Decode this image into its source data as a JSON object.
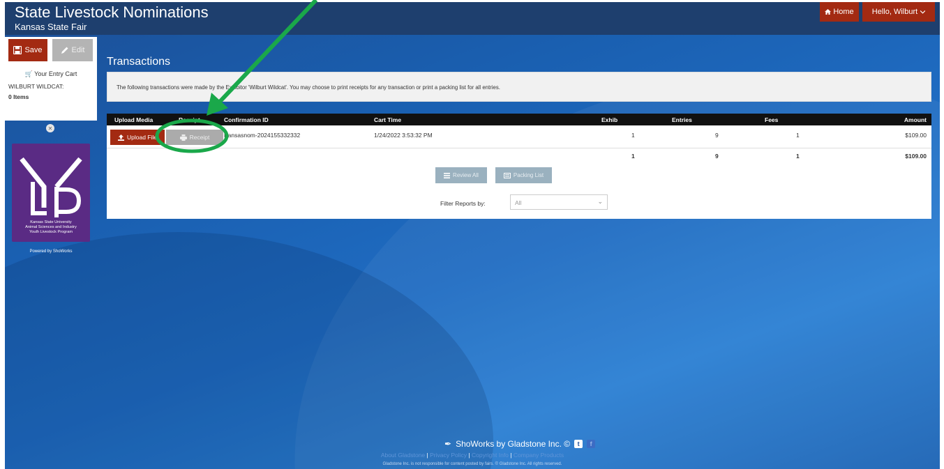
{
  "header": {
    "title": "State Livestock Nominations",
    "subtitle": "Kansas State Fair",
    "home_label": "Home",
    "user_label": "Hello, Wilburt"
  },
  "sidebar": {
    "save_label": "Save",
    "edit_label": "Edit",
    "cart_heading": "Your Entry Cart",
    "cart_user": "WILBURT WILDCAT:",
    "cart_items": "0 Items",
    "logo_caption_1": "Kansas State University",
    "logo_caption_2": "Animal Sciences and Industry",
    "logo_caption_3": "Youth Livestock Program",
    "powered_by": "Powered by ShoWorks"
  },
  "main": {
    "page_title": "Transactions",
    "info_text": "The following transactions were made by the Exhibitor 'Wilburt Wildcat'. You may choose to print receipts for any transaction or print a packing list for all entries.",
    "columns": {
      "upload_media": "Upload Media",
      "receipt": "Receipt",
      "confirmation_id": "Confirmation ID",
      "cart_time": "Cart Time",
      "exhib": "Exhib",
      "entries": "Entries",
      "fees": "Fees",
      "amount": "Amount"
    },
    "row": {
      "upload_label": "Upload File",
      "receipt_label": "Receipt",
      "confirmation_id": "Kansasnom-2024155332332",
      "cart_time": "1/24/2022 3:53:32 PM",
      "exhib": "1",
      "entries": "9",
      "fees": "1",
      "amount": "$109.00"
    },
    "totals": {
      "exhib": "1",
      "entries": "9",
      "fees": "1",
      "amount": "$109.00"
    },
    "review_all_label": "Review All",
    "packing_list_label": "Packing List",
    "filter_label": "Filter Reports by:",
    "filter_value": "All"
  },
  "footer": {
    "brand": "ShoWorks by Gladstone Inc. ©",
    "links": [
      "About Gladstone",
      "Privacy Policy",
      "Copyright Info",
      "Company Products"
    ],
    "notice": "Gladstone Inc. is not responsible for content posted by fairs. © Gladstone Inc. All rights reserved."
  },
  "annotation": {
    "arrow_color": "#1aa84a",
    "circle_color": "#1aa84a"
  }
}
